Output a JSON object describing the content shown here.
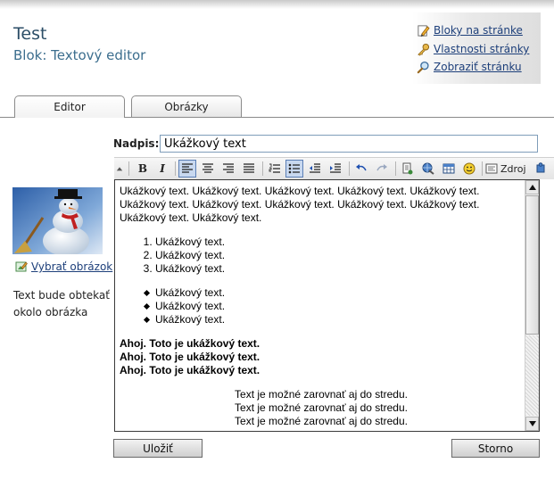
{
  "header": {
    "title": "Test",
    "subtitle": "Blok: Textový editor",
    "links": [
      {
        "label": "Bloky na stránke",
        "icon": "pencil-icon"
      },
      {
        "label": "Vlastnosti stránky",
        "icon": "key-icon"
      },
      {
        "label": "Zobraziť stránku",
        "icon": "magnifier-icon"
      }
    ]
  },
  "tabs": [
    {
      "label": "Editor",
      "active": true
    },
    {
      "label": "Obrázky",
      "active": false
    }
  ],
  "sidebar": {
    "pick_image_label": "Vybrať obrázok",
    "wrap_note": "Text bude obtekať okolo obrázka"
  },
  "form": {
    "nadpis_label": "Nadpis:",
    "nadpis_value": "Ukážkový text"
  },
  "toolbar": {
    "source_label": "Zdroj"
  },
  "editor": {
    "paragraph": "Ukážkový text. Ukážkový text. Ukážkový text. Ukážkový text. Ukážkový text. Ukážkový text. Ukážkový text. Ukážkový text. Ukážkový text. Ukážkový text. Ukážkový text. Ukážkový text.",
    "ordered": [
      "Ukážkový text.",
      "Ukážkový text.",
      "Ukážkový text."
    ],
    "bullets": [
      "Ukážkový text.",
      "Ukážkový text.",
      "Ukážkový text."
    ],
    "bold_lines": [
      "Ahoj. Toto je ukážkový text.",
      "Ahoj. Toto je ukážkový text.",
      "Ahoj. Toto je ukážkový text."
    ],
    "center_lines": [
      "Text je možné zarovnať aj do stredu.",
      "Text je možné zarovnať aj do stredu.",
      "Text je možné zarovnať aj do stredu."
    ]
  },
  "buttons": {
    "save": "Uložiť",
    "cancel": "Storno"
  }
}
